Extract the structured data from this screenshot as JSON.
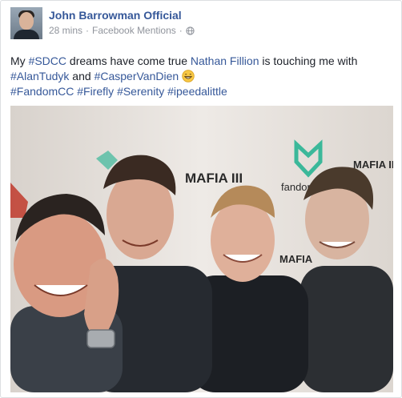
{
  "post": {
    "author": "John Barrowman Official",
    "time": "28 mins",
    "separator": "·",
    "source": "Facebook Mentions",
    "separator2": "·",
    "line1": {
      "t1": "My ",
      "h1": "#SDCC",
      "t2": " dreams have come true ",
      "m1": "Nathan Fillion",
      "t3": " is touching me with"
    },
    "line2": {
      "h1": "#AlanTudyk",
      "t1": " and ",
      "h2": "#CasperVanDien"
    },
    "line3": {
      "h1": "#FandomCC",
      "h2": "#Firefly",
      "h3": "#Serenity",
      "h4": "#ipeedalittle"
    }
  },
  "photo": {
    "backdrop_logo_1": "MAFIA III",
    "backdrop_logo_2": "fandom",
    "backdrop_logo_3": "MAFIA III",
    "backdrop_logo_4": "MAFIA",
    "backdrop_logo_5": "dom"
  },
  "colors": {
    "link": "#365899",
    "meta": "#90949c",
    "text": "#1d2129"
  },
  "icons": {
    "visibility": "globe-icon",
    "emoji": "grinning-face-icon"
  }
}
